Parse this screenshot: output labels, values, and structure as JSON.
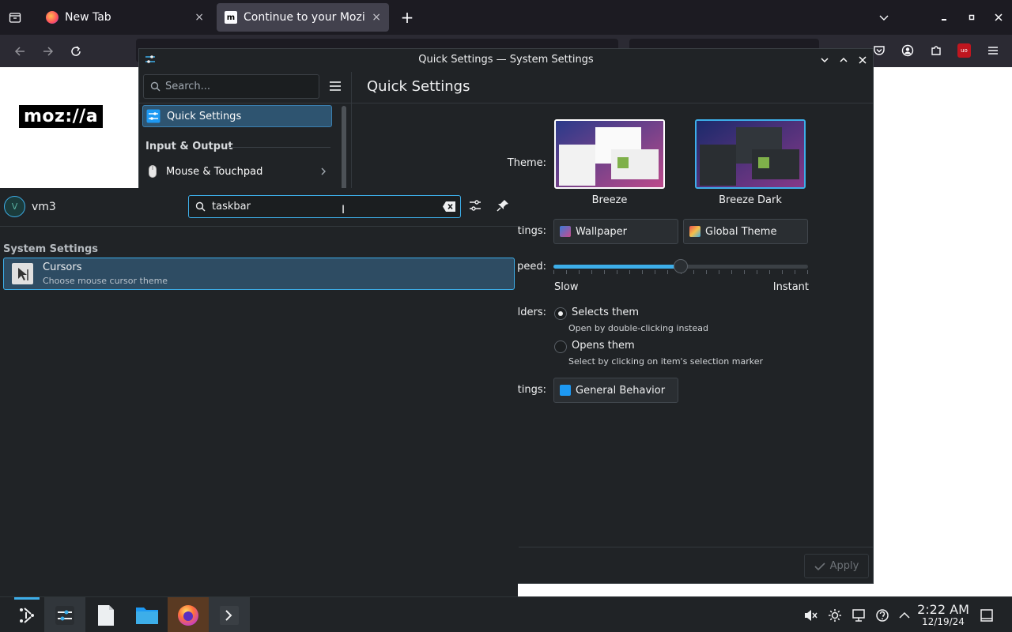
{
  "firefox": {
    "tabs": [
      {
        "label": "New Tab",
        "close": "×"
      },
      {
        "label": "Continue to your Mozilla",
        "close": "×"
      }
    ],
    "new_tab": "+",
    "page_logo": "moz://a"
  },
  "settings": {
    "window_title": "Quick Settings — System Settings",
    "search_placeholder": "Search...",
    "page_title": "Quick Settings",
    "sidebar": {
      "selected": "Quick Settings",
      "category": "Input & Output",
      "items": [
        "Mouse & Touchpad"
      ]
    },
    "theme": {
      "label": "Theme:",
      "options": [
        {
          "name": "Breeze"
        },
        {
          "name": "Breeze Dark"
        }
      ]
    },
    "more_appearance": {
      "label": "ttings:",
      "buttons": [
        "Wallpaper",
        "Global Theme"
      ]
    },
    "animation": {
      "label": "peed:",
      "min_label": "Slow",
      "max_label": "Instant",
      "value_fraction": 0.5
    },
    "clicking": {
      "label": "lders:",
      "options": [
        {
          "title": "Selects them",
          "desc": "Open by double-clicking instead",
          "checked": true
        },
        {
          "title": "Opens them",
          "desc": "Select by clicking on item's selection marker",
          "checked": false
        }
      ]
    },
    "more_behavior": {
      "label": "ttings:",
      "button": "General Behavior"
    },
    "apply_label": "Apply"
  },
  "runner": {
    "user": "vm3",
    "avatar_letter": "V",
    "query": "taskbar",
    "category": "System Settings",
    "results": [
      {
        "title": "Cursors",
        "subtitle": "Choose mouse cursor theme"
      }
    ]
  },
  "taskbar": {
    "time": "2:22 AM",
    "date": "12/19/24"
  },
  "colors": {
    "accent": "#3daee9",
    "selection": "#2e4c63",
    "window_bg": "#202326"
  }
}
